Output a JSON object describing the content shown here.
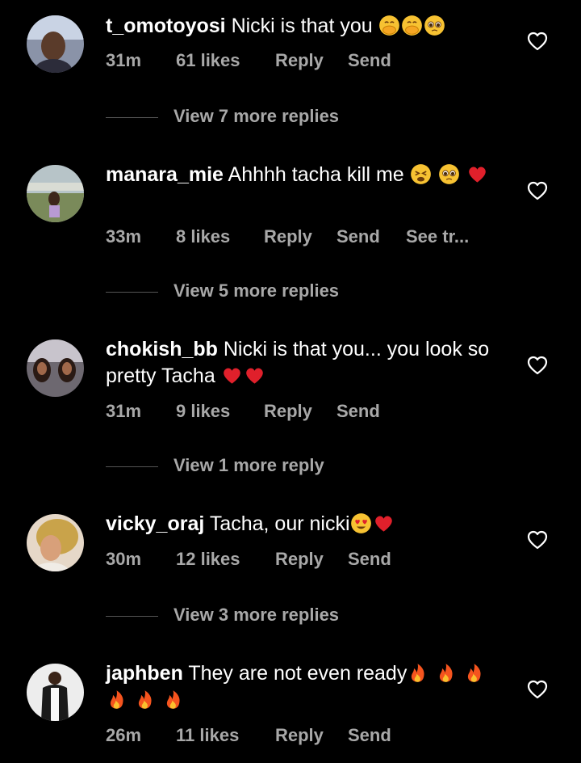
{
  "comments": [
    {
      "username": "t_omotoyosi",
      "text": "Nicki is that you",
      "time": "31m",
      "likes": "61 likes",
      "reply": "Reply",
      "send": "Send",
      "view_replies": "View 7 more replies"
    },
    {
      "username": "manara_mie",
      "text": "Ahhhh tacha kill me",
      "time": "33m",
      "likes": "8 likes",
      "reply": "Reply",
      "send": "Send",
      "see": "See tr...",
      "view_replies": "View 5 more replies"
    },
    {
      "username": "chokish_bb",
      "text": "Nicki is that you... you look so pretty Tacha",
      "time": "31m",
      "likes": "9 likes",
      "reply": "Reply",
      "send": "Send",
      "view_replies": "View 1 more reply"
    },
    {
      "username": "vicky_oraj",
      "text": "Tacha, our nicki",
      "time": "30m",
      "likes": "12 likes",
      "reply": "Reply",
      "send": "Send",
      "view_replies": "View 3 more replies"
    },
    {
      "username": "japhben",
      "text": "They are not even ready",
      "time": "26m",
      "likes": "11 likes",
      "reply": "Reply",
      "send": "Send"
    }
  ],
  "icons": {
    "heart_outline": "heart-outline-icon",
    "emoji": [
      "hand-over-mouth-emoji",
      "pleading-face-emoji",
      "tired-face-emoji",
      "red-heart-emoji",
      "heart-eyes-emoji",
      "fire-emoji"
    ]
  },
  "colors": {
    "background": "#000000",
    "text": "#ffffff",
    "secondary": "#a8a8a8"
  }
}
